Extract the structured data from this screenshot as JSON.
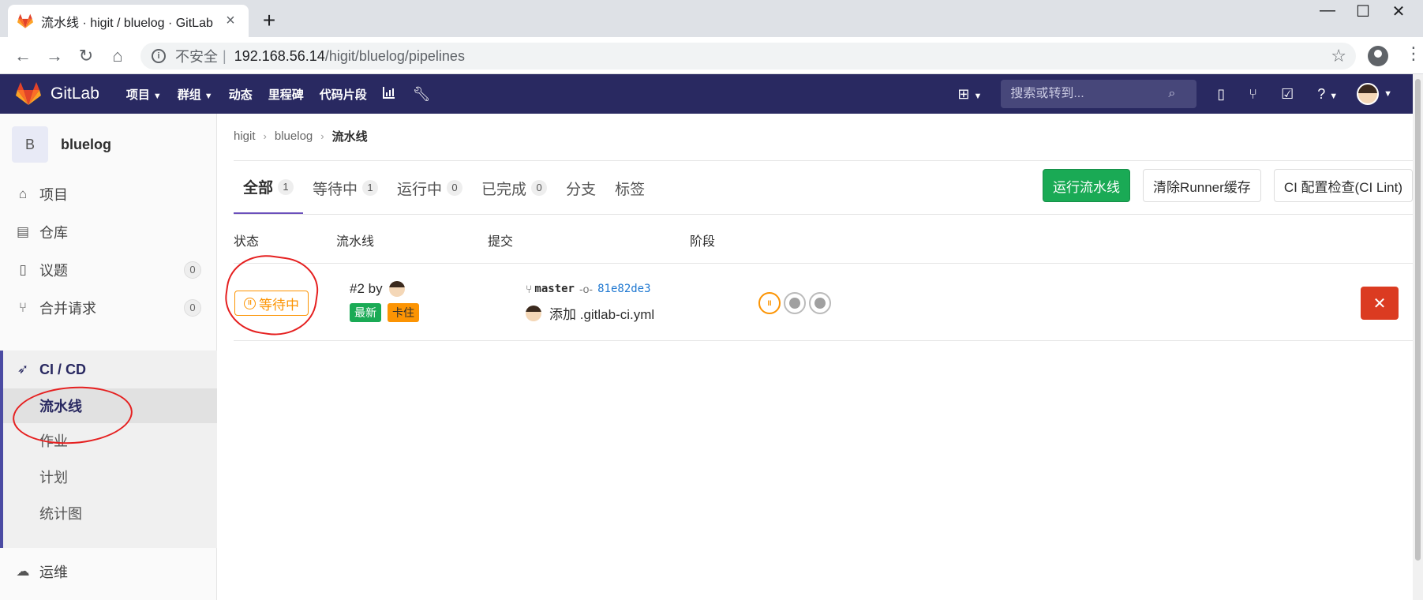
{
  "browser": {
    "tab_title": "流水线 · higit / bluelog · GitLab",
    "address_insecure": "不安全",
    "address_sep": "|",
    "url_host": "192.168.56.14",
    "url_path": "/higit/bluelog/pipelines"
  },
  "header": {
    "brand": "GitLab",
    "nav": [
      {
        "label": "项目"
      },
      {
        "label": "群组"
      },
      {
        "label": "动态"
      },
      {
        "label": "里程碑"
      },
      {
        "label": "代码片段"
      }
    ],
    "search_placeholder": "搜索或转到..."
  },
  "sidebar": {
    "project_initial": "B",
    "project_name": "bluelog",
    "items": {
      "project": "项目",
      "repository": "仓库",
      "issues": "议题",
      "issues_count": "0",
      "merge_requests": "合并请求",
      "merge_requests_count": "0",
      "cicd": "CI / CD",
      "ops": "运维"
    },
    "cicd_sub": {
      "pipelines": "流水线",
      "jobs": "作业",
      "schedules": "计划",
      "charts": "统计图"
    }
  },
  "breadcrumb": {
    "group": "higit",
    "project": "bluelog",
    "current": "流水线"
  },
  "tabs": {
    "all": "全部",
    "all_count": "1",
    "pending": "等待中",
    "pending_count": "1",
    "running": "运行中",
    "running_count": "0",
    "finished": "已完成",
    "finished_count": "0",
    "branches": "分支",
    "tags": "标签"
  },
  "actions": {
    "run_pipeline": "运行流水线",
    "clear_cache": "清除Runner缓存",
    "ci_lint": "CI 配置检查(CI Lint)"
  },
  "table": {
    "col_status": "状态",
    "col_pipeline": "流水线",
    "col_commit": "提交",
    "col_stages": "阶段"
  },
  "pipeline": {
    "status": "等待中",
    "id_by": "#2 by",
    "tag_latest": "最新",
    "tag_stuck": "卡住",
    "branch": "master",
    "sha": "81e82de3",
    "message": "添加 .gitlab-ci.yml"
  },
  "colors": {
    "header_bg": "#292961",
    "primary_green": "#1aaa55",
    "pending_orange": "#fc9403",
    "danger_red": "#db3b21",
    "link_blue": "#1f78d1",
    "annotation_red": "#e52020"
  }
}
